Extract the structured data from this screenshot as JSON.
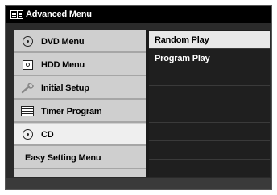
{
  "title": "Advanced Menu",
  "menu": {
    "items": [
      {
        "label": "DVD Menu",
        "icon": "disc-icon"
      },
      {
        "label": "HDD Menu",
        "icon": "hdd-icon"
      },
      {
        "label": "Initial Setup",
        "icon": "wrench-icon"
      },
      {
        "label": "Timer Program",
        "icon": "timer-icon"
      },
      {
        "label": "CD",
        "icon": "disc-icon",
        "selected": true
      },
      {
        "label": "Easy Setting Menu",
        "icon": ""
      }
    ]
  },
  "submenu": {
    "items": [
      {
        "label": "Random Play",
        "highlighted": true
      },
      {
        "label": "Program Play"
      }
    ]
  },
  "colors": {
    "title_bar": "#000000",
    "menu_bg": "#cfcfcf",
    "menu_selected": "#efefef",
    "submenu_bg": "#1f1f1f",
    "submenu_highlight": "#e8e8e8"
  }
}
